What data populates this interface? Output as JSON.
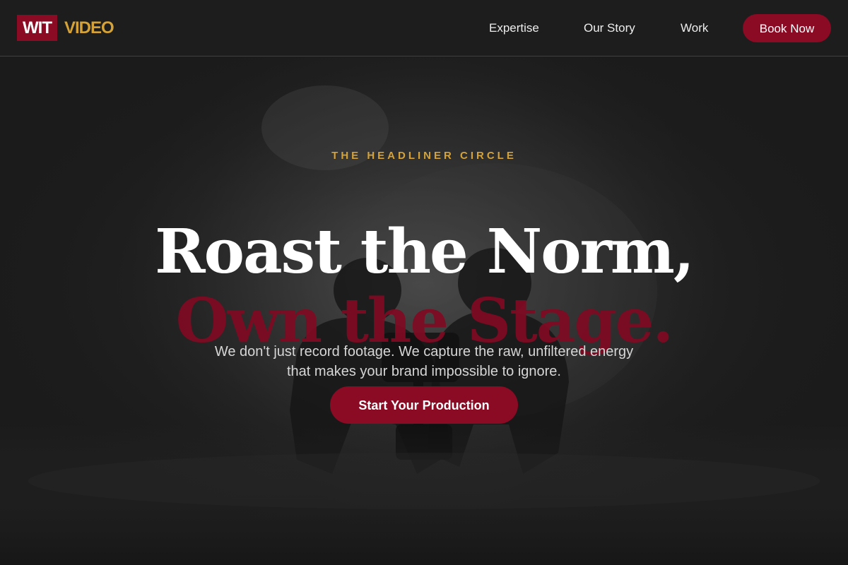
{
  "header": {
    "logo": {
      "part1": "WIT",
      "part2": "VIDEO"
    },
    "nav": {
      "expertise": "Expertise",
      "our_story": "Our Story",
      "work": "Work"
    },
    "book_now": "Book Now"
  },
  "hero": {
    "eyebrow": "THE HEADLINER CIRCLE",
    "headline_line1": "Roast the Norm,",
    "headline_line2": "Own the Stage.",
    "subtext_line1": "We don't just record footage. We capture the raw, unfiltered energy",
    "subtext_line2": "that makes your brand impossible to ignore.",
    "cta": "Start Your Production",
    "background_image": "camera-operators-silhouette-photo"
  },
  "colors": {
    "brand_red": "#8b0a24",
    "accent_gold": "#d4a236",
    "background": "#1b1b1b",
    "text_primary": "#ffffff"
  }
}
